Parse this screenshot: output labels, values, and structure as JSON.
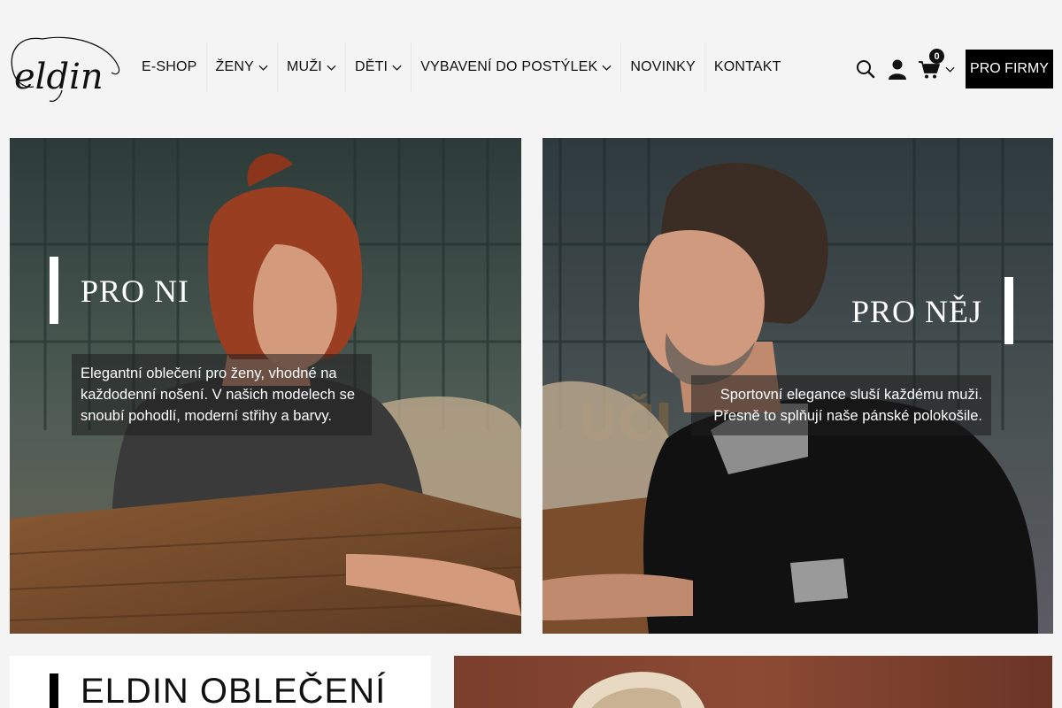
{
  "brand": {
    "logo_text": "eldin"
  },
  "nav": {
    "items": [
      {
        "label": "E-SHOP",
        "has_dropdown": false
      },
      {
        "label": "ŽENY",
        "has_dropdown": true
      },
      {
        "label": "MUŽI",
        "has_dropdown": true
      },
      {
        "label": "DĚTI",
        "has_dropdown": true
      },
      {
        "label": "VYBAVENÍ DO POSTÝLEK",
        "has_dropdown": true
      },
      {
        "label": "NOVINKY",
        "has_dropdown": false
      },
      {
        "label": "KONTAKT",
        "has_dropdown": false
      }
    ]
  },
  "header_icons": {
    "search": "search-icon",
    "account": "user-icon",
    "cart": "cart-icon",
    "cart_count": "0"
  },
  "cta": {
    "pro_firmy": "PRO FIRMY"
  },
  "banners": {
    "left": {
      "title": "PRO NI",
      "description": "Elegantní oblečení pro ženy, vhodné na každodenní nošení. V našich modelech se snoubí pohodlí, moderní střihy a barvy."
    },
    "right": {
      "title": "PRO NĚJ",
      "description_line1": "Sportovní elegance sluší každému muži.",
      "description_line2": "Přesně to splňují naše pánské polokošile."
    }
  },
  "intro": {
    "title": "ELDIN OBLEČENÍ"
  },
  "colors": {
    "accent": "#000000",
    "background": "#f4f4f4",
    "text": "#111111"
  }
}
